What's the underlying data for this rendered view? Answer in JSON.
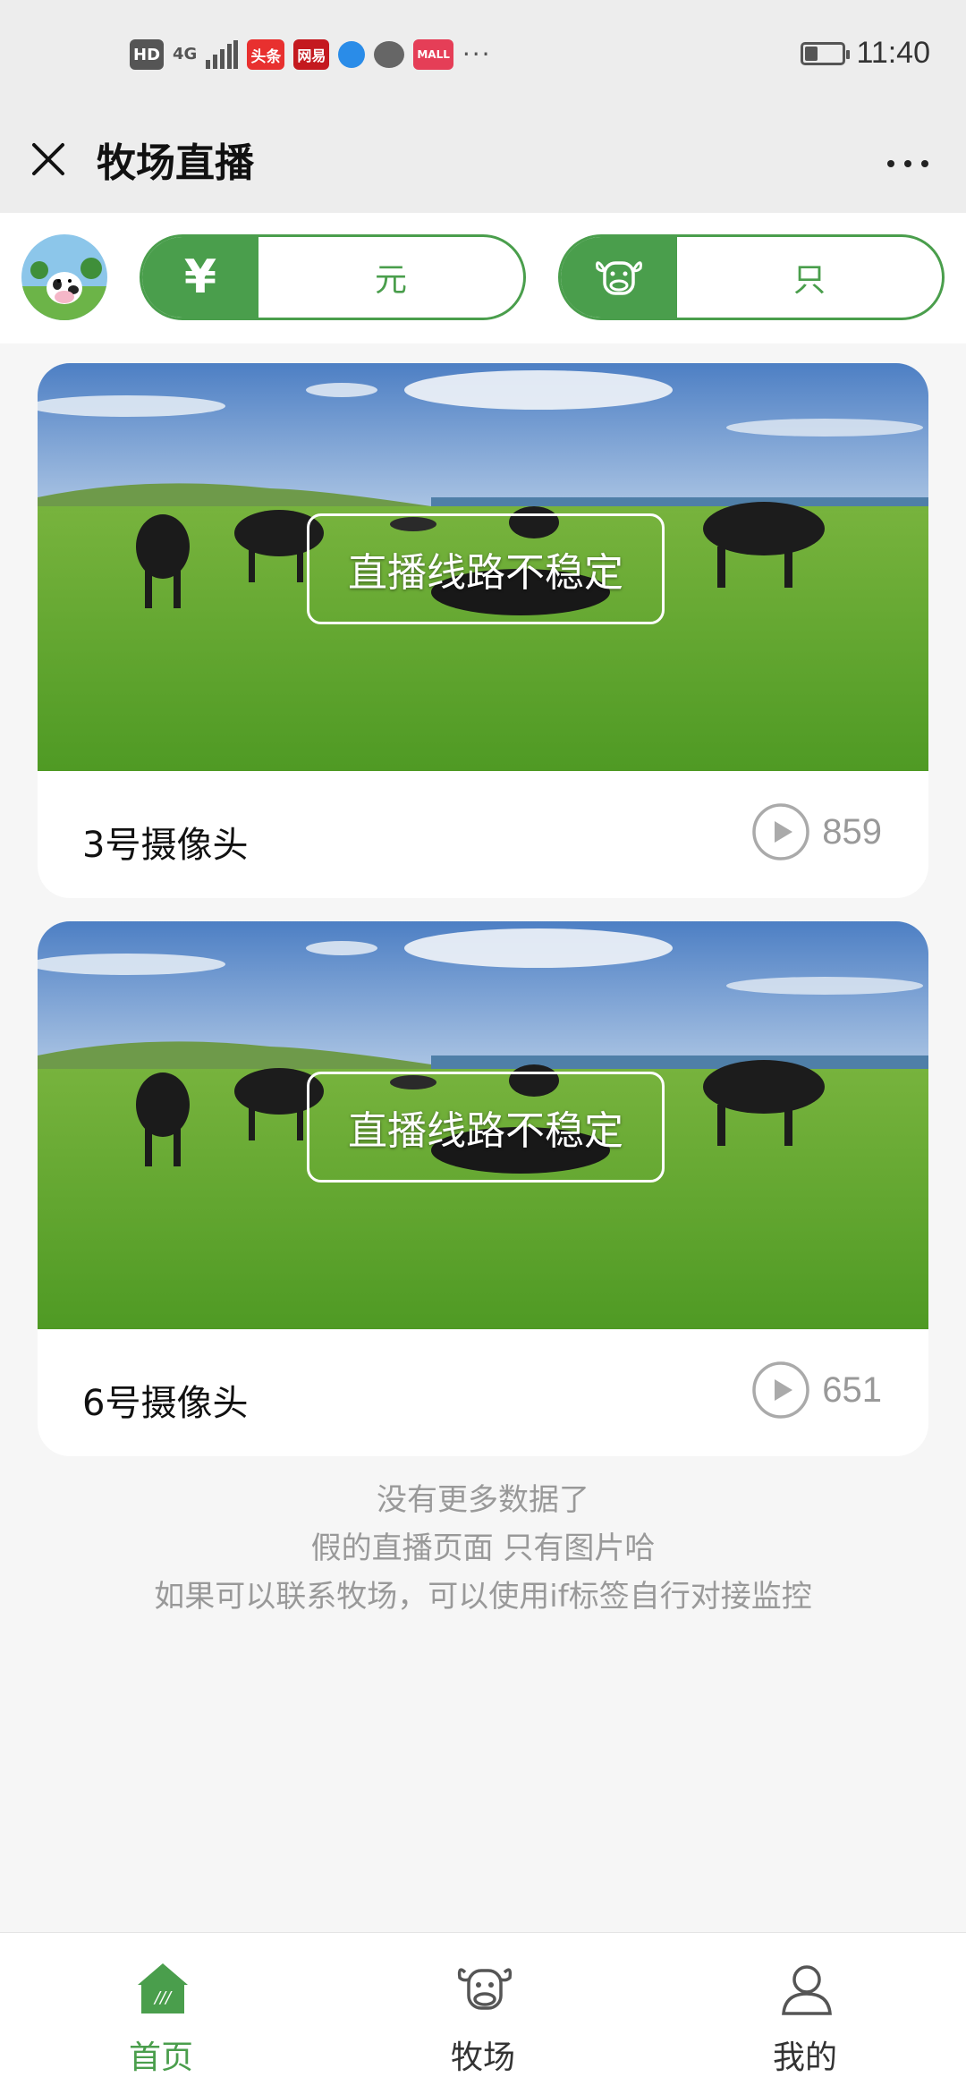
{
  "status_bar": {
    "time": "11:40",
    "network": "4G",
    "hd_label": "HD",
    "app_badges": [
      "头条",
      "网易",
      "MALL"
    ],
    "more": "···",
    "battery_percent": 35
  },
  "navbar": {
    "title": "牧场直播"
  },
  "stats": {
    "money_symbol": "¥",
    "money_value": "元",
    "cow_value": "只"
  },
  "cameras": [
    {
      "name": "3号摄像头",
      "status_overlay": "直播线路不稳定",
      "views": "859"
    },
    {
      "name": "6号摄像头",
      "status_overlay": "直播线路不稳定",
      "views": "651"
    }
  ],
  "footer_notes": [
    "没有更多数据了",
    "假的直播页面 只有图片哈",
    "如果可以联系牧场，可以使用if标签自行对接监控"
  ],
  "tabbar": {
    "items": [
      {
        "label": "首页",
        "icon": "home-icon",
        "active": true
      },
      {
        "label": "牧场",
        "icon": "cow-icon",
        "active": false
      },
      {
        "label": "我的",
        "icon": "user-icon",
        "active": false
      }
    ]
  },
  "colors": {
    "brand_green": "#4a9e4c",
    "sky": "#5b86c9",
    "grass": "#5ea52f"
  }
}
